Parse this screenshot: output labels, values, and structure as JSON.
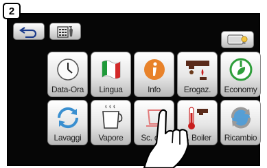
{
  "step_number": "2",
  "tiles_row1": [
    {
      "label": "Data-Ora",
      "icon": "clock-icon"
    },
    {
      "label": "Lingua",
      "icon": "italian-flag-icon"
    },
    {
      "label": "Info",
      "icon": "info-icon"
    },
    {
      "label": "Erogaz.",
      "icon": "dispensing-icon"
    },
    {
      "label": "Economy",
      "icon": "power-leaf-icon"
    }
  ],
  "tiles_row2": [
    {
      "label": "Lavaggi",
      "icon": "rinse-icon"
    },
    {
      "label": "Vapore",
      "icon": "steam-pitcher-icon"
    },
    {
      "label": "Sc. dat.",
      "icon": "cup-outline-icon"
    },
    {
      "label": "T. Boiler",
      "icon": "thermometer-icon"
    },
    {
      "label": "Ricambio",
      "icon": "water-refresh-icon"
    }
  ],
  "colors": {
    "screen_bg": "#060606",
    "tile_top": "#ffffff",
    "tile_bottom": "#b9b9b9",
    "info_orange": "#e8822a",
    "economy_green": "#2e9e3a",
    "rinse_blue": "#3a8fd0"
  }
}
